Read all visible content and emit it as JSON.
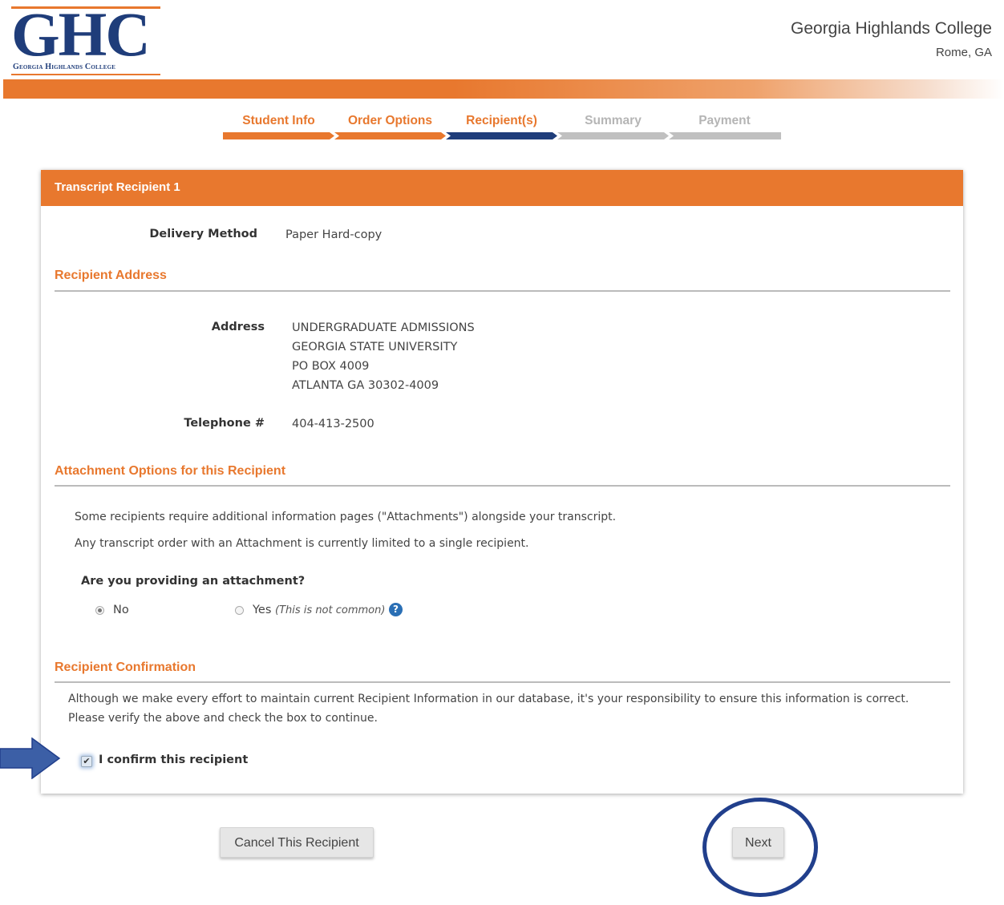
{
  "header": {
    "logo_letters": "GHC",
    "logo_subtitle": "Georgia Highlands College",
    "college_name": "Georgia Highlands College",
    "college_location": "Rome, GA"
  },
  "steps": [
    {
      "label": "Student Info",
      "state": "done"
    },
    {
      "label": "Order Options",
      "state": "done"
    },
    {
      "label": "Recipient(s)",
      "state": "current"
    },
    {
      "label": "Summary",
      "state": "pending"
    },
    {
      "label": "Payment",
      "state": "pending"
    }
  ],
  "colors": {
    "accent": "#e8782e",
    "current_step": "#1f3d7a",
    "pending": "#c0c0c0",
    "annotation": "#213f8c"
  },
  "card": {
    "title": "Transcript Recipient 1",
    "delivery_method_label": "Delivery Method",
    "delivery_method_value": "Paper Hard-copy",
    "recipient_address_title": "Recipient Address",
    "address_label": "Address",
    "address_lines": [
      "UNDERGRADUATE ADMISSIONS",
      "GEORGIA STATE UNIVERSITY",
      "PO BOX 4009",
      "ATLANTA GA 30302-4009"
    ],
    "telephone_label": "Telephone #",
    "telephone_value": "404-413-2500",
    "attachment_title": "Attachment Options for this Recipient",
    "attachment_para_1": "Some recipients require additional information pages (\"Attachments\") alongside your transcript.",
    "attachment_para_2": "Any transcript order with an Attachment is currently limited to a single recipient.",
    "attachment_question": "Are you providing an attachment?",
    "radio_no_label": "No",
    "radio_yes_label": "Yes",
    "radio_yes_note": "(This is not common)",
    "selected_option": "No",
    "help_icon": "question-circle-icon",
    "confirmation_title": "Recipient Confirmation",
    "confirmation_para_1": "Although we make every effort to maintain current Recipient Information in our database, it's your responsibility to ensure this information is correct.",
    "confirmation_para_2": "Please verify the above and check the box to continue.",
    "confirm_label": "I confirm this recipient",
    "confirm_checked": true
  },
  "buttons": {
    "cancel": "Cancel This Recipient",
    "next": "Next"
  }
}
